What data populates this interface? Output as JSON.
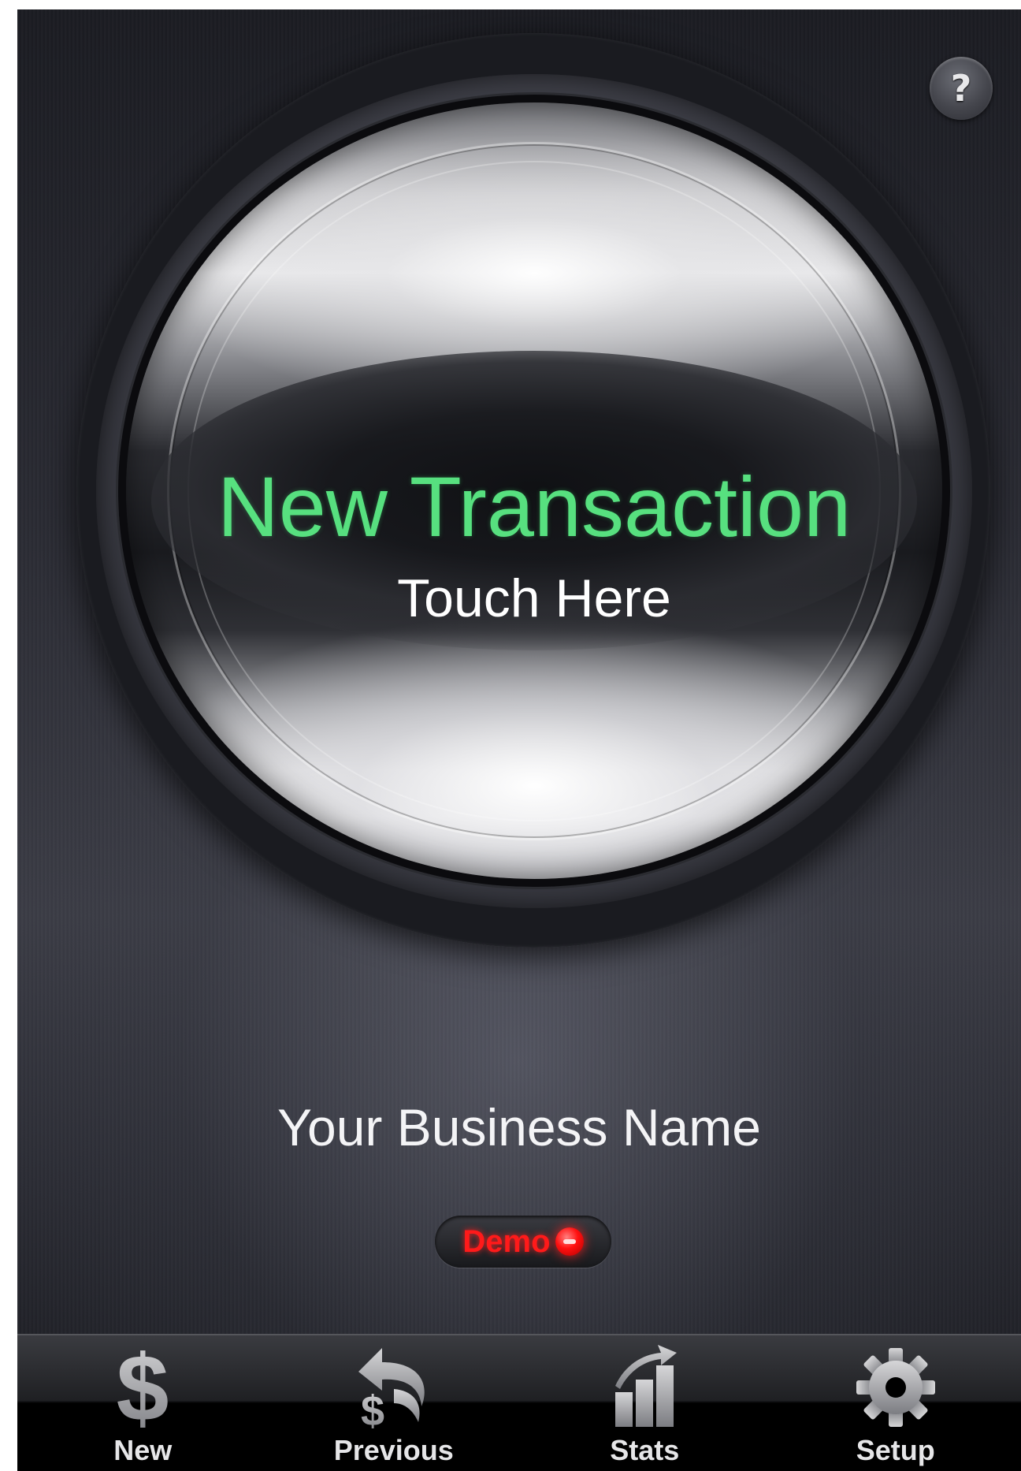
{
  "help": {
    "label": "?"
  },
  "dial": {
    "title": "New Transaction",
    "subtitle": "Touch Here"
  },
  "business": {
    "name": "Your Business Name"
  },
  "demo_badge": {
    "label": "Demo"
  },
  "tab_bar": {
    "items": [
      {
        "label": "New",
        "icon": "dollar-icon"
      },
      {
        "label": "Previous",
        "icon": "undo-dollar-icon"
      },
      {
        "label": "Stats",
        "icon": "bar-chart-icon"
      },
      {
        "label": "Setup",
        "icon": "gear-icon"
      }
    ]
  },
  "colors": {
    "title_green": "#57e07f",
    "demo_red": "#ff1a1a"
  }
}
